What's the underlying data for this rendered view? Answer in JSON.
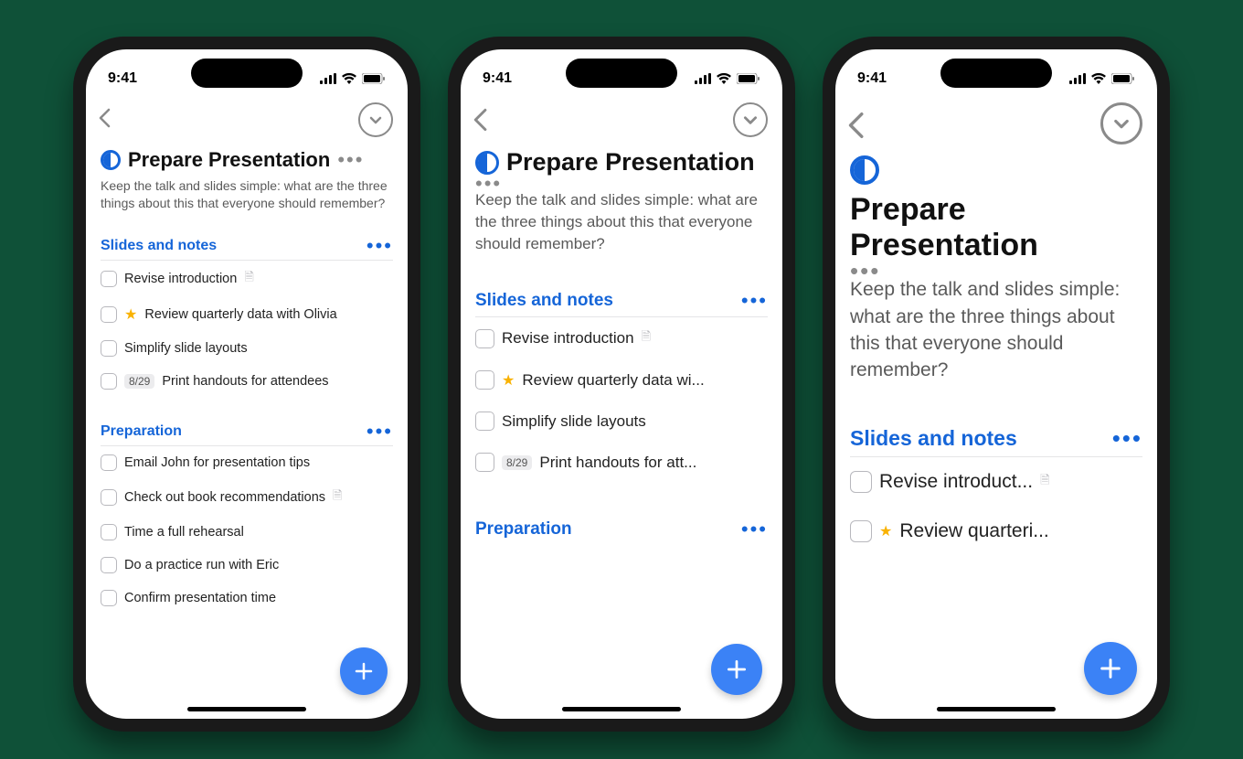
{
  "statusbar": {
    "time": "9:41"
  },
  "project": {
    "title": "Prepare Presentation",
    "description": "Keep the talk and slides simple: what are the three things about this that everyone should remember?"
  },
  "sections": [
    {
      "title": "Slides and notes",
      "tasks": [
        {
          "text": "Revise introduction",
          "has_file": true
        },
        {
          "text": "Review quarterly data with Olivia",
          "starred": true
        },
        {
          "text": "Simplify slide layouts"
        },
        {
          "text": "Print handouts for attendees",
          "date": "8/29"
        }
      ]
    },
    {
      "title": "Preparation",
      "tasks": [
        {
          "text": "Email John for presentation tips"
        },
        {
          "text": "Check out book recommendations",
          "has_file": true
        },
        {
          "text": "Time a full rehearsal"
        },
        {
          "text": "Do a practice run with Eric"
        },
        {
          "text": "Confirm presentation time"
        }
      ]
    }
  ],
  "truncated": {
    "p2_task1": "Review quarterly data wi...",
    "p2_task3": "Print handouts for att...",
    "p3_task0": "Revise introduct...",
    "p3_task1": "Review quarteri..."
  },
  "colors": {
    "accent": "#1565d8",
    "fab": "#3b82f6"
  }
}
